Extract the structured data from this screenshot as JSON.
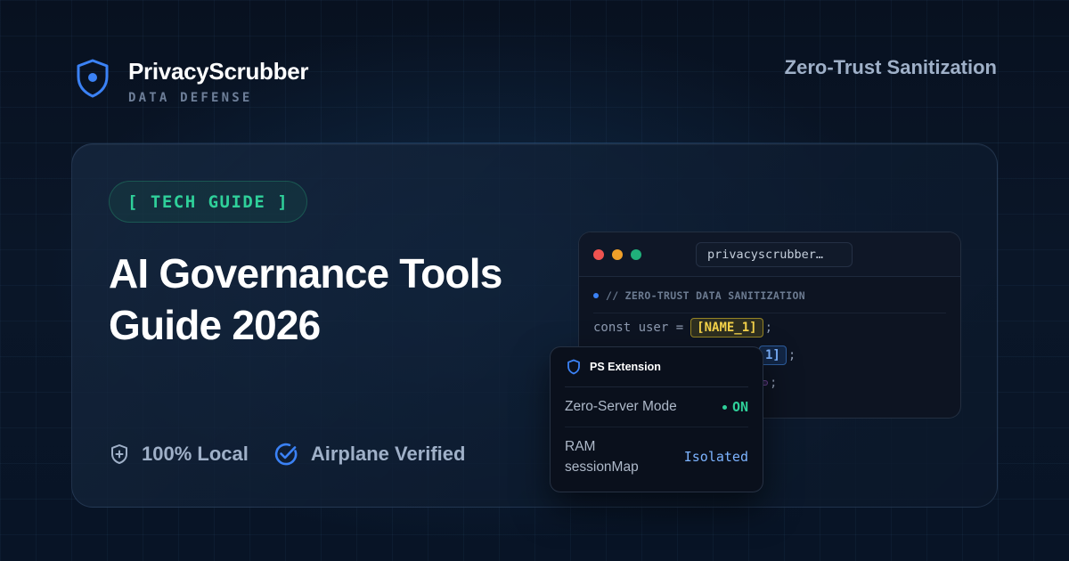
{
  "brand": {
    "name": "PrivacyScrubber",
    "tagline": "DATA DEFENSE",
    "header_right": "Zero-Trust Sanitization"
  },
  "card": {
    "badge": "[ TECH GUIDE ]",
    "title_line1": "AI Governance Tools",
    "title_line2": "Guide 2026",
    "features": [
      {
        "icon": "shield-plus-icon",
        "label": "100% Local"
      },
      {
        "icon": "check-circle-icon",
        "label": "Airplane Verified"
      }
    ]
  },
  "code_window": {
    "url": "privacyscrubber…",
    "comment": "// ZERO-TRUST DATA SANITIZATION",
    "lines": [
      {
        "prefix": "const user = ",
        "token": "[NAME_1]",
        "suffix": ";"
      },
      {
        "prefix": "",
        "token": "1]",
        "suffix": ";"
      },
      {
        "prefix": "",
        "token": "",
        "suffix": ";"
      }
    ]
  },
  "extension_popup": {
    "title": "PS Extension",
    "row1_label": "Zero-Server Mode",
    "row1_value": "ON",
    "row2_label": "RAM sessionMap",
    "row2_value": "Isolated"
  },
  "colors": {
    "accent_green": "#2fd09a",
    "accent_blue": "#3b82f6",
    "token_yellow": "#f5d34a",
    "token_blue": "#7cb3ff",
    "token_purple": "#c28bf0",
    "traffic_red": "#ef5350",
    "traffic_yellow": "#f0a029",
    "traffic_green": "#20b07a"
  }
}
